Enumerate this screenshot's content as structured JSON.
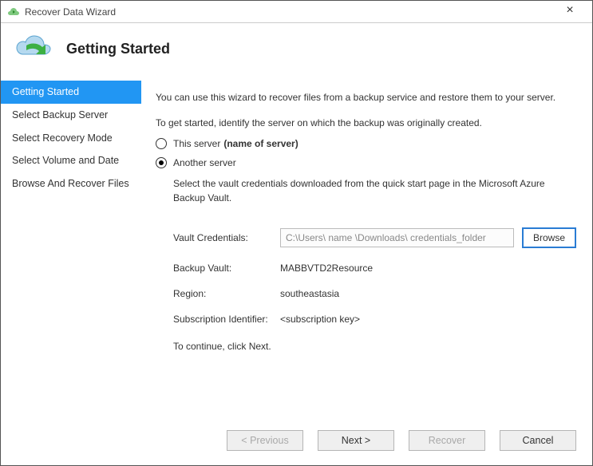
{
  "window": {
    "title": "Recover Data Wizard",
    "close_label": "×"
  },
  "header": {
    "title": "Getting Started"
  },
  "sidebar": {
    "items": [
      {
        "label": "Getting Started"
      },
      {
        "label": "Select Backup Server"
      },
      {
        "label": "Select Recovery Mode"
      },
      {
        "label": "Select Volume and Date"
      },
      {
        "label": "Browse And Recover Files"
      }
    ],
    "active_index": 0
  },
  "content": {
    "intro1": "You can use this wizard to recover files from a backup service and restore them to your server.",
    "intro2": "To get started, identify the server on which the backup was originally created.",
    "radio_this": "This server",
    "radio_this_suffix": "(name of server)",
    "radio_another": "Another server",
    "selected_radio": "another",
    "vault_instruction": "Select the vault credentials downloaded from the quick start page in the Microsoft Azure Backup Vault.",
    "vault_credentials_label": "Vault Credentials:",
    "vault_credentials_value": "C:\\Users\\ name \\Downloads\\ credentials_folder",
    "browse_label": "Browse",
    "backup_vault_label": "Backup Vault:",
    "backup_vault_value": "MABBVTD2Resource",
    "region_label": "Region:",
    "region_value": "southeastasia",
    "subscription_label": "Subscription Identifier:",
    "subscription_value": "<subscription key>",
    "continue_text": "To continue, click Next."
  },
  "footer": {
    "previous": "< Previous",
    "next": "Next >",
    "recover": "Recover",
    "cancel": "Cancel"
  }
}
